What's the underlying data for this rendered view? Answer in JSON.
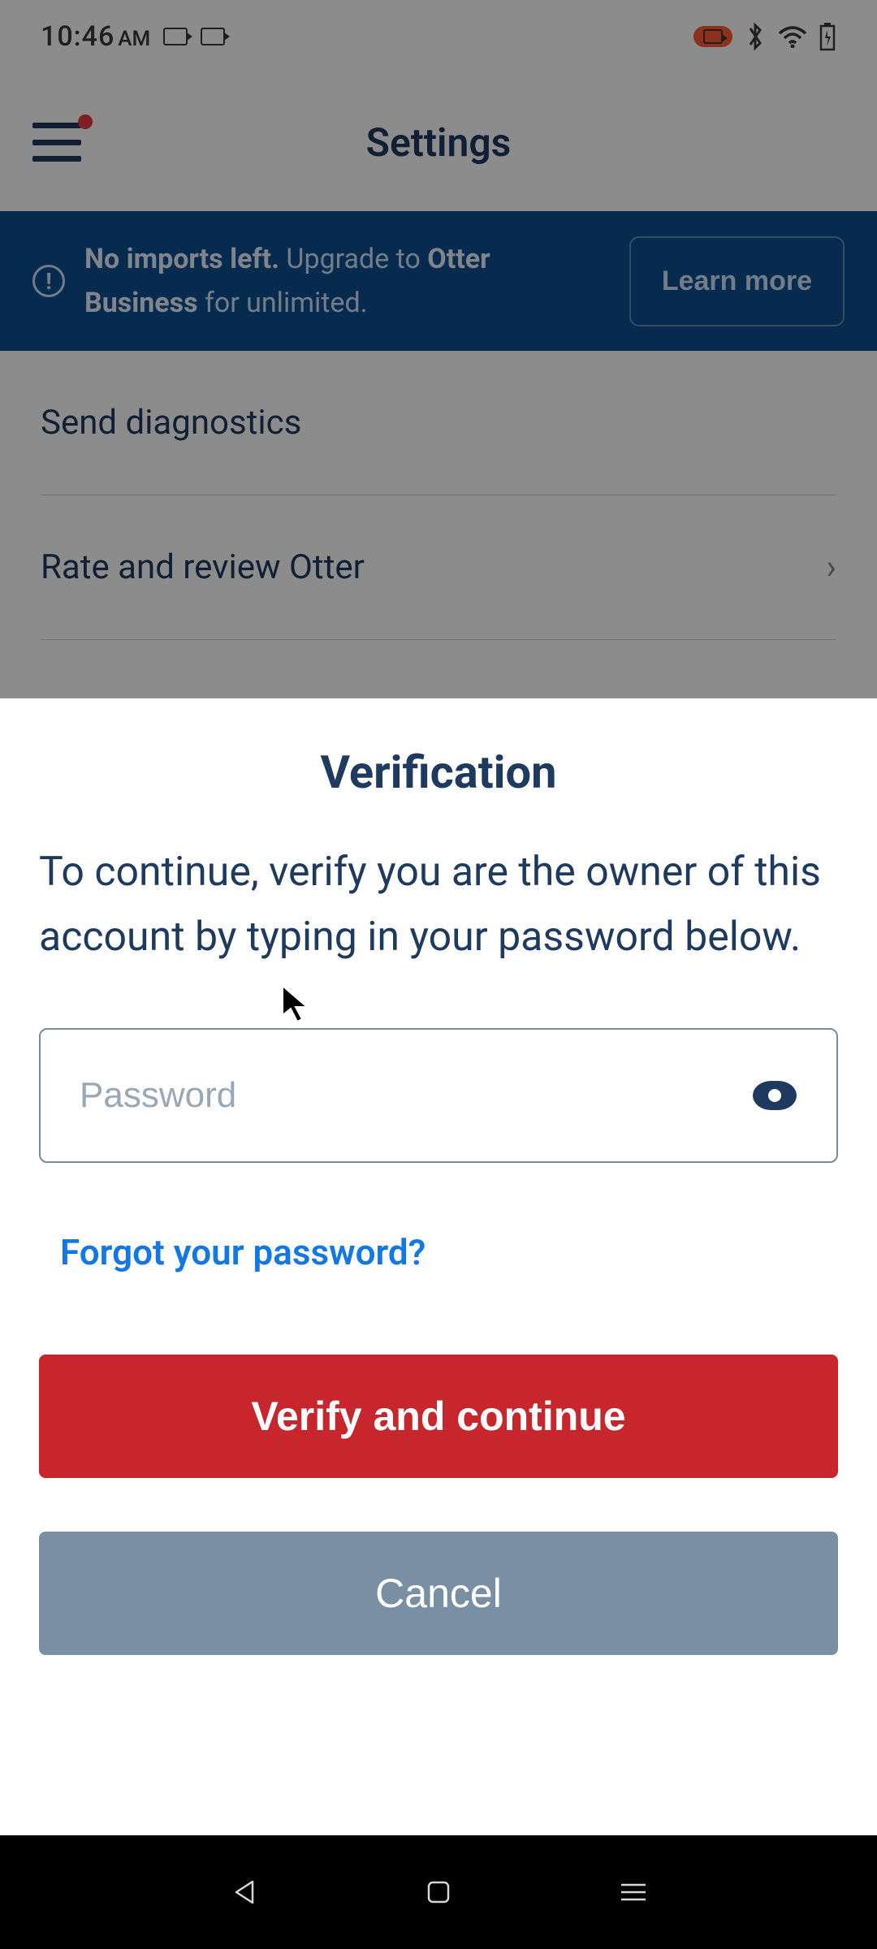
{
  "status": {
    "time": "10:46",
    "ampm": "AM"
  },
  "header": {
    "title": "Settings"
  },
  "banner": {
    "prefix": "No imports left.",
    "mid": " Upgrade to ",
    "brand": "Otter Business",
    "suffix": " for unlimited.",
    "cta": "Learn more"
  },
  "list": {
    "items": [
      {
        "label": "Send diagnostics",
        "chevron": false
      },
      {
        "label": "Rate and review Otter",
        "chevron": true
      }
    ]
  },
  "modal": {
    "title": "Verification",
    "description": "To continue, verify you are the owner of this account by typing in your password below.",
    "password_placeholder": "Password",
    "forgot": "Forgot your password?",
    "verify": "Verify and continue",
    "cancel": "Cancel"
  }
}
